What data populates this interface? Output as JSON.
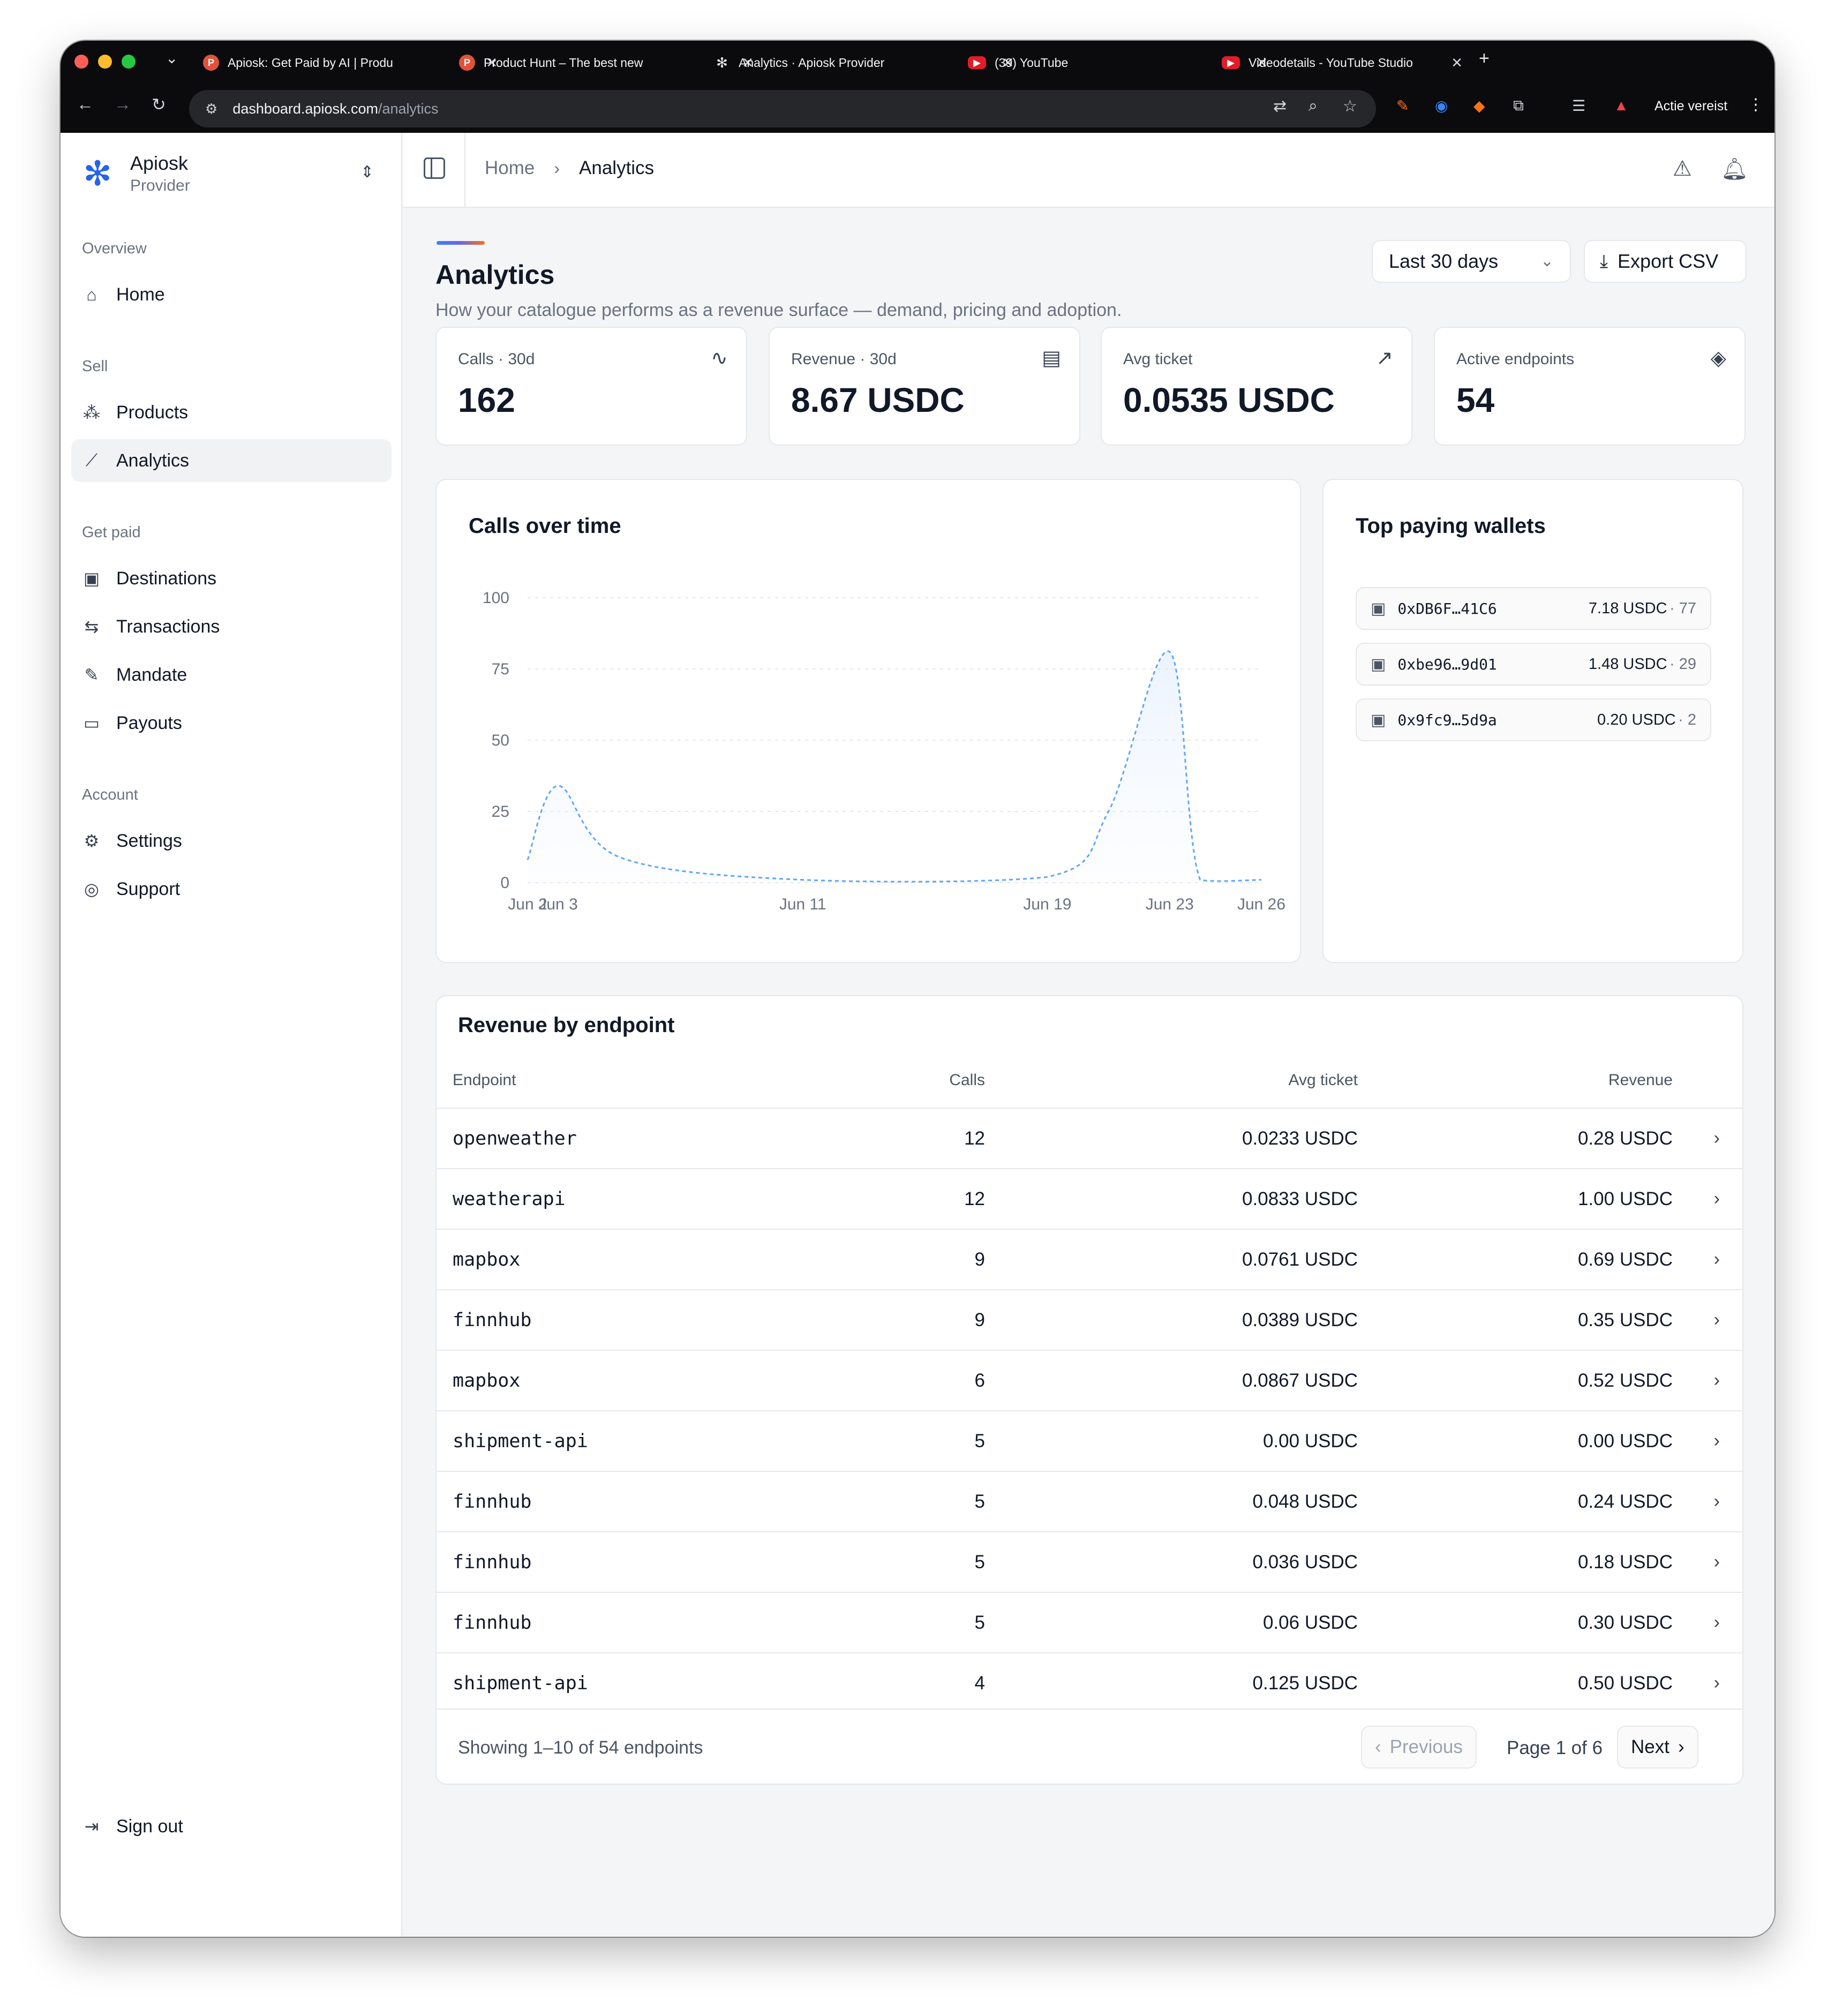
{
  "browser": {
    "tabs": [
      {
        "title": "Apiosk: Get Paid by AI | Produ",
        "favicon": "P",
        "favicon_kind": "product-hunt"
      },
      {
        "title": "Product Hunt – The best new",
        "favicon": "P",
        "favicon_kind": "product-hunt"
      },
      {
        "title": "Analytics · Apiosk Provider",
        "favicon": "✻",
        "favicon_kind": "apiosk"
      },
      {
        "title": "(39) YouTube",
        "favicon": "▶",
        "favicon_kind": "youtube"
      },
      {
        "title": "Videodetails - YouTube Studio",
        "favicon": "▶",
        "favicon_kind": "youtube"
      }
    ],
    "url_host": "dashboard.apiosk.com",
    "url_path": "/analytics",
    "profile_label": "Actie vereist"
  },
  "brand": {
    "name": "Apiosk",
    "subtitle": "Provider",
    "logo_icon": "asterisk-icon",
    "accent": "#2563eb"
  },
  "sidebar": {
    "groups": [
      {
        "label": "Overview",
        "items": [
          {
            "label": "Home",
            "icon": "home-icon"
          }
        ]
      },
      {
        "label": "Sell",
        "items": [
          {
            "label": "Products",
            "icon": "boxes-icon"
          },
          {
            "label": "Analytics",
            "icon": "line-chart-icon",
            "active": true
          }
        ]
      },
      {
        "label": "Get paid",
        "items": [
          {
            "label": "Destinations",
            "icon": "wallet-icon"
          },
          {
            "label": "Transactions",
            "icon": "arrows-icon"
          },
          {
            "label": "Mandate",
            "icon": "file-sign-icon"
          },
          {
            "label": "Payouts",
            "icon": "banknote-icon"
          }
        ]
      },
      {
        "label": "Account",
        "items": [
          {
            "label": "Settings",
            "icon": "gear-icon"
          },
          {
            "label": "Support",
            "icon": "lifebuoy-icon"
          }
        ]
      }
    ],
    "sign_out": "Sign out"
  },
  "breadcrumb": {
    "home": "Home",
    "current": "Analytics"
  },
  "page": {
    "title": "Analytics",
    "subtitle": "How your catalogue performs as a revenue surface — demand, pricing and adoption.",
    "range": "Last 30 days",
    "export": "Export CSV"
  },
  "kpis": [
    {
      "label": "Calls · 30d",
      "value": "162",
      "icon": "activity-icon"
    },
    {
      "label": "Revenue · 30d",
      "value": "8.67 USDC",
      "icon": "receipt-icon"
    },
    {
      "label": "Avg ticket",
      "value": "0.0535 USDC",
      "icon": "trending-up-icon"
    },
    {
      "label": "Active endpoints",
      "value": "54",
      "icon": "layers-icon"
    }
  ],
  "chart": {
    "title": "Calls over time"
  },
  "chart_data": {
    "type": "area",
    "title": "Calls over time",
    "xlabel": "",
    "ylabel": "",
    "x_ticks": [
      "Jun 2",
      "Jun 3",
      "Jun 11",
      "Jun 19",
      "Jun 23",
      "Jun 26"
    ],
    "y_ticks": [
      0,
      25,
      50,
      75,
      100
    ],
    "ylim": [
      0,
      100
    ],
    "grid": true,
    "line_color": "#60a5fa",
    "points": [
      {
        "x": "Jun 2",
        "y": 8
      },
      {
        "x": "Jun 3",
        "y": 34
      },
      {
        "x": "Jun 5",
        "y": 9
      },
      {
        "x": "Jun 11",
        "y": 1
      },
      {
        "x": "Jun 19",
        "y": 2
      },
      {
        "x": "Jun 21",
        "y": 25
      },
      {
        "x": "Jun 23",
        "y": 81
      },
      {
        "x": "Jun 24",
        "y": 1
      },
      {
        "x": "Jun 26",
        "y": 1
      }
    ]
  },
  "wallets": {
    "title": "Top paying wallets",
    "items": [
      {
        "address": "0xDB6F…41C6",
        "amount": "7.18 USDC",
        "count": "· 77"
      },
      {
        "address": "0xbe96…9d01",
        "amount": "1.48 USDC",
        "count": "· 29"
      },
      {
        "address": "0x9fc9…5d9a",
        "amount": "0.20 USDC",
        "count": "· 2"
      }
    ]
  },
  "table": {
    "title": "Revenue by endpoint",
    "headers": {
      "endpoint": "Endpoint",
      "calls": "Calls",
      "avg": "Avg ticket",
      "revenue": "Revenue"
    },
    "rows": [
      {
        "endpoint": "openweather",
        "calls": "12",
        "avg": "0.0233 USDC",
        "revenue": "0.28 USDC"
      },
      {
        "endpoint": "weatherapi",
        "calls": "12",
        "avg": "0.0833 USDC",
        "revenue": "1.00 USDC"
      },
      {
        "endpoint": "mapbox",
        "calls": "9",
        "avg": "0.0761 USDC",
        "revenue": "0.69 USDC"
      },
      {
        "endpoint": "finnhub",
        "calls": "9",
        "avg": "0.0389 USDC",
        "revenue": "0.35 USDC"
      },
      {
        "endpoint": "mapbox",
        "calls": "6",
        "avg": "0.0867 USDC",
        "revenue": "0.52 USDC"
      },
      {
        "endpoint": "shipment-api",
        "calls": "5",
        "avg": "0.00 USDC",
        "revenue": "0.00 USDC"
      },
      {
        "endpoint": "finnhub",
        "calls": "5",
        "avg": "0.048 USDC",
        "revenue": "0.24 USDC"
      },
      {
        "endpoint": "finnhub",
        "calls": "5",
        "avg": "0.036 USDC",
        "revenue": "0.18 USDC"
      },
      {
        "endpoint": "finnhub",
        "calls": "5",
        "avg": "0.06 USDC",
        "revenue": "0.30 USDC"
      },
      {
        "endpoint": "shipment-api",
        "calls": "4",
        "avg": "0.125 USDC",
        "revenue": "0.50 USDC"
      }
    ],
    "showing": "Showing 1–10 of 54 endpoints",
    "prev": "Previous",
    "page_info": "Page 1 of 6",
    "next": "Next"
  }
}
